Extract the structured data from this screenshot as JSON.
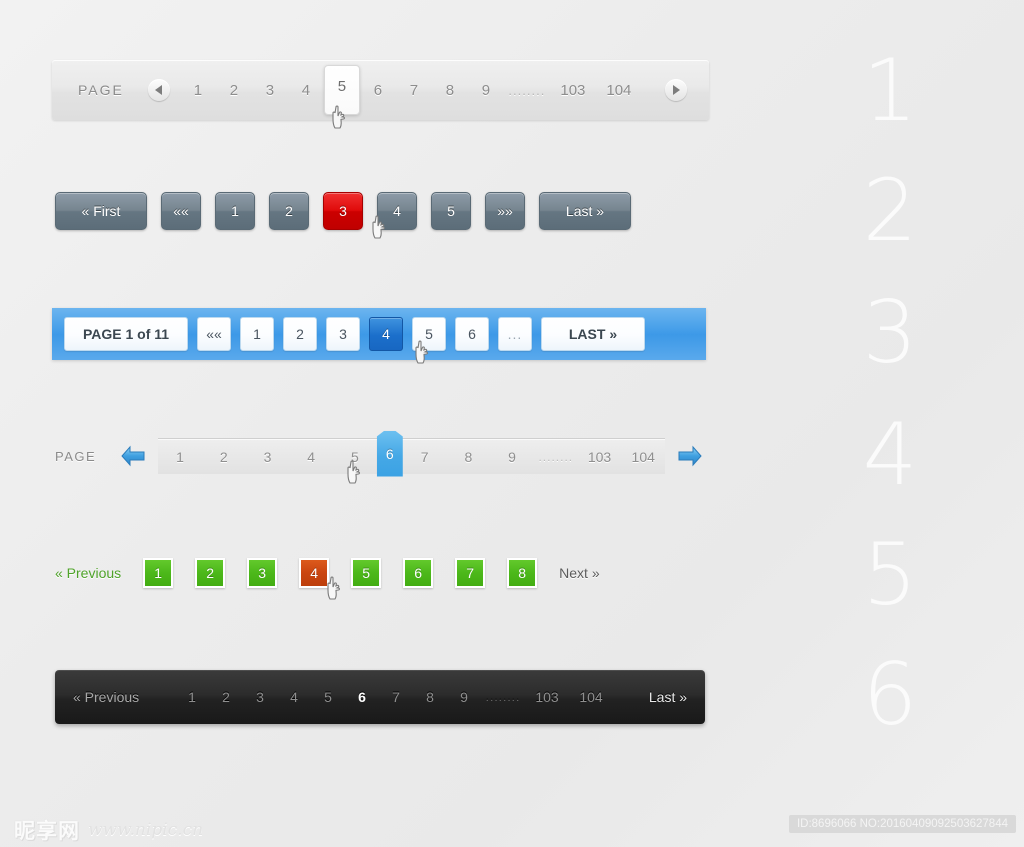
{
  "ghost_numbers": [
    "1",
    "2",
    "3",
    "4",
    "5",
    "6"
  ],
  "bar1": {
    "label": "PAGE",
    "prev_icon": "triangle-left-icon",
    "next_icon": "triangle-right-icon",
    "pages": [
      "1",
      "2",
      "3",
      "4",
      "5",
      "6",
      "7",
      "8",
      "9",
      "........",
      "103",
      "104"
    ],
    "active": "5"
  },
  "bar2": {
    "first_label": "« First",
    "prev_label": "««",
    "pages": [
      "1",
      "2",
      "3",
      "4",
      "5"
    ],
    "next_label": "»»",
    "last_label": "Last »",
    "active": "3",
    "accent_color": "#cc0000",
    "base_color": "#6b7c8c"
  },
  "bar3": {
    "page_label": "PAGE 1 of 11",
    "prev_label": "««",
    "pages": [
      "1",
      "2",
      "3",
      "4",
      "5",
      "6"
    ],
    "dots": "...",
    "last_label": "LAST »",
    "active": "4",
    "bar_color": "#3d99e7",
    "accent_color": "#1867c2"
  },
  "bar4": {
    "label": "PAGE",
    "prev_icon": "arrow-left-icon",
    "next_icon": "arrow-right-icon",
    "pages": [
      "1",
      "2",
      "3",
      "4",
      "5",
      "6",
      "7",
      "8",
      "9",
      "........",
      "103",
      "104"
    ],
    "active": "6",
    "accent_color": "#45a8e6"
  },
  "bar5": {
    "prev_label": "« Previous",
    "next_label": "Next »",
    "pages": [
      "1",
      "2",
      "3",
      "4",
      "5",
      "6",
      "7",
      "8"
    ],
    "active": "4",
    "base_color": "#4cb81a",
    "accent_color": "#ca4510"
  },
  "bar6": {
    "prev_label": "« Previous",
    "pages": [
      "1",
      "2",
      "3",
      "4",
      "5",
      "6",
      "7",
      "8",
      "9",
      "........",
      "103",
      "104"
    ],
    "last_label": "Last »",
    "active": "6",
    "bar_color": "#222222"
  },
  "footer": {
    "watermark_cn": "昵享网",
    "watermark_url": "www.nipic.cn",
    "id_text": "ID:8696066 NO:20160409092503627844"
  }
}
